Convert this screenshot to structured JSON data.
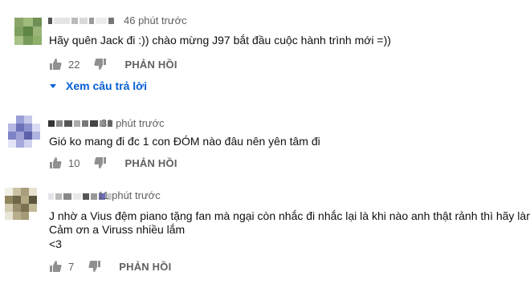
{
  "comments": [
    {
      "time": "46 phút trước",
      "text_lines": [
        "Hãy quên Jack đi :)) chào mừng J97 bắt đầu cuộc hành trình mới =))"
      ],
      "likes": "22",
      "reply_label": "PHẢN HỒI",
      "view_replies": "Xem câu trả lời"
    },
    {
      "time": "31 phút trước",
      "text_lines": [
        "Gió ko mang đi đc 1 con ĐÓM nào đâu nên yên tâm đi"
      ],
      "likes": "10",
      "reply_label": "PHẢN HỒI"
    },
    {
      "time": "11 phút trước",
      "text_lines": [
        "J nhờ a Vius đệm piano tặng fan mà ngại còn nhắc đi nhắc lại là khi nào anh thật rảnh thì hãy làm",
        "Cảm ơn a Viruss nhiều lắm",
        "<3"
      ],
      "likes": "7",
      "reply_label": "PHẢN HỒI"
    }
  ],
  "colors": {
    "link_blue": "#065fd4",
    "meta_gray": "#606060",
    "text": "#0f0f0f"
  }
}
